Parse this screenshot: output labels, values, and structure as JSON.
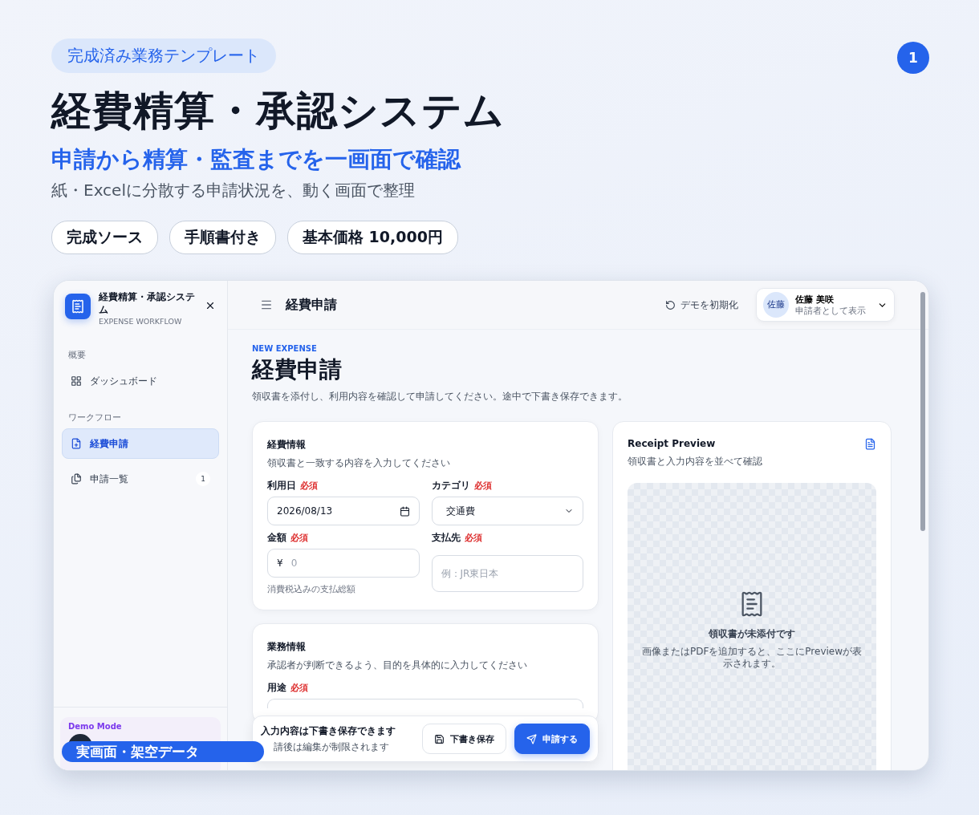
{
  "header": {
    "tag": "完成済み業務テンプレート",
    "title": "経費精算・承認システム",
    "subtitle": "申請から精算・監査までを一画面で確認",
    "description": "紙・Excelに分散する申請状況を、動く画面で整理",
    "chips": [
      "完成ソース",
      "手順書付き",
      "基本価格 10,000円"
    ],
    "page_badge": "1"
  },
  "app": {
    "sidebar": {
      "app_name": "経費精算・承認システム",
      "app_subtitle": "EXPENSE WORKFLOW",
      "sections": [
        {
          "heading": "概要",
          "items": [
            {
              "label": "ダッシュボード",
              "kind": "dashboard",
              "selected": false
            }
          ]
        },
        {
          "heading": "ワークフロー",
          "items": [
            {
              "label": "経費申請",
              "kind": "compose",
              "selected": true
            },
            {
              "label": "申請一覧",
              "kind": "list",
              "selected": false,
              "count": "1"
            }
          ]
        }
      ],
      "demo": {
        "label": "Demo Mode"
      }
    },
    "topbar": {
      "title": "経費申請",
      "reset": "デモを初期化",
      "user": {
        "avatar": "佐藤",
        "name": "佐藤 美咲",
        "role": "申請者として表示"
      }
    },
    "page": {
      "eyebrow": "NEW EXPENSE",
      "title": "経費申請",
      "description": "領収書を添付し、利用内容を確認して申請してください。途中で下書き保存できます。"
    },
    "form_cards": [
      {
        "title": "経費情報",
        "subtitle": "領収書と一致する内容を入力してください",
        "fields": [
          {
            "label": "利用日",
            "required": "必須",
            "kind": "date",
            "value": "2026/08/13"
          },
          {
            "label": "カテゴリ",
            "required": "必須",
            "kind": "select",
            "value": "交通費"
          },
          {
            "label": "金額",
            "required": "必須",
            "kind": "amount",
            "prefix": "¥",
            "placeholder": "0",
            "hint": "消費税込みの支払総額"
          },
          {
            "label": "支払先",
            "required": "必須",
            "kind": "text",
            "placeholder": "例：JR東日本"
          }
        ]
      },
      {
        "title": "業務情報",
        "subtitle": "承認者が判断できるよう、目的を具体的に入力してください",
        "fields": [
          {
            "label": "用途",
            "required": "必須",
            "kind": "textarea"
          }
        ]
      }
    ],
    "action_bar": {
      "note": "入力内容は下書き保存できます",
      "subnote": "請後は編集が制限されます",
      "draft_button": "下書き保存",
      "submit_button": "申請する"
    },
    "preview": {
      "title": "Receipt Preview",
      "subtitle": "領収書と入力内容を並べて確認",
      "empty_title": "領収書が未添付です",
      "empty_text": "画像またはPDFを追加すると、ここにPreviewが表示されます。"
    },
    "overlay_label": "実画面・架空データ"
  }
}
